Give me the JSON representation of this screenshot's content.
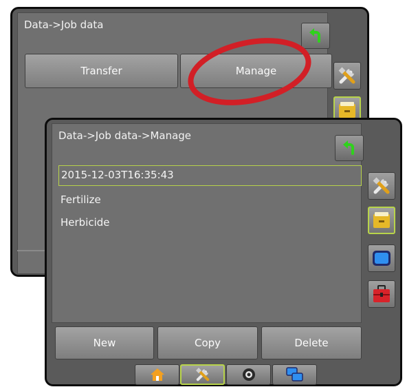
{
  "back_screen": {
    "title": "Data->Job data",
    "buttons": {
      "transfer": "Transfer",
      "manage": "Manage"
    }
  },
  "front_screen": {
    "title": "Data->Job data->Manage",
    "jobs": [
      "2015-12-03T16:35:43",
      "Fertilize",
      "Herbicide"
    ],
    "selected_index": 0,
    "buttons": {
      "new": "New",
      "copy": "Copy",
      "delete": "Delete"
    }
  },
  "colors": {
    "panel": "#5a5a5a",
    "content": "#707070",
    "selection_border": "#b7d24a",
    "highlight_ellipse": "#d21f26",
    "undo_arrow": "#2fd21c"
  },
  "icons": {
    "undo": "undo-arrow-icon",
    "tools": "tools-icon",
    "data": "data-folder-icon",
    "display": "display-icon",
    "toolbox": "toolbox-icon",
    "home": "home-icon",
    "camera": "camera-icon",
    "screens": "screens-icon"
  }
}
